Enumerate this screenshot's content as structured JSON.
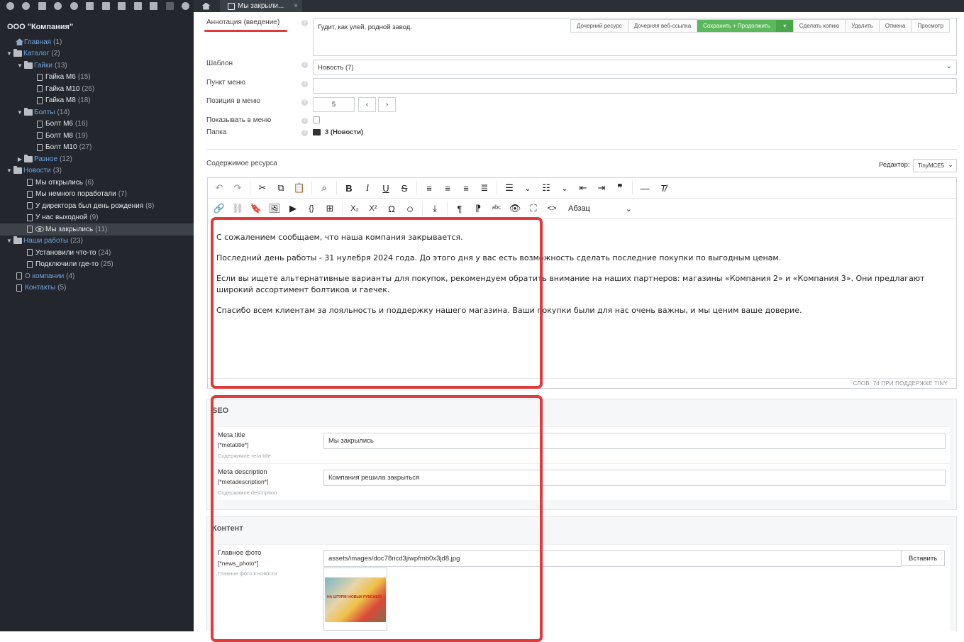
{
  "sidebar": {
    "root_label": "ООО \"Компания\"",
    "toolbar_icons": [
      "arrow-down-circle-icon",
      "arrow-up-circle-icon",
      "new-document-icon",
      "link-icon",
      "refresh-icon",
      "sort-icon",
      "sort-numeric-icon",
      "camera-icon",
      "copy-icon",
      "grid-icon",
      "trash-icon",
      "contrast-icon"
    ],
    "tree": [
      {
        "label": "Главная",
        "count": "(1)",
        "level": 0
      },
      {
        "label": "Каталог",
        "count": "(2)",
        "level": 0
      },
      {
        "label": "Гайки",
        "count": "(13)",
        "level": 1
      },
      {
        "label": "Гайка М6",
        "count": "(15)",
        "level": 2
      },
      {
        "label": "Гайка М10",
        "count": "(26)",
        "level": 2
      },
      {
        "label": "Гайка М8",
        "count": "(18)",
        "level": 2
      },
      {
        "label": "Болты",
        "count": "(14)",
        "level": 1
      },
      {
        "label": "Болт М6",
        "count": "(16)",
        "level": 2
      },
      {
        "label": "Болт М8",
        "count": "(19)",
        "level": 2
      },
      {
        "label": "Болт М10",
        "count": "(27)",
        "level": 2
      },
      {
        "label": "Разное",
        "count": "(12)",
        "level": 1
      },
      {
        "label": "Новости",
        "count": "(3)",
        "level": 0
      },
      {
        "label": "Мы открылись",
        "count": "(6)",
        "level": 1
      },
      {
        "label": "Мы немного поработали",
        "count": "(7)",
        "level": 1
      },
      {
        "label": "У директора был день рождения",
        "count": "(8)",
        "level": 1
      },
      {
        "label": "У нас выходной",
        "count": "(9)",
        "level": 1
      },
      {
        "label": "Мы закрылись",
        "count": "(11)",
        "level": 1
      },
      {
        "label": "Наши работы",
        "count": "(23)",
        "level": 0
      },
      {
        "label": "Установили что-то",
        "count": "(24)",
        "level": 1
      },
      {
        "label": "Подключили где-то",
        "count": "(25)",
        "level": 1
      },
      {
        "label": "О компании",
        "count": "(4)",
        "level": 0
      },
      {
        "label": "Контакты",
        "count": "(5)",
        "level": 0
      }
    ]
  },
  "tabs": {
    "active_label": "Мы закрыли...",
    "close": "×"
  },
  "actions": {
    "child_resource": "Дочерний ресурс",
    "child_weblink": "Дочерняя веб-ссылка",
    "save_continue": "Сохранить + Продолжить",
    "make_copy": "Сделать копию",
    "delete": "Удалить",
    "cancel": "Отмена",
    "view": "Просмотр"
  },
  "form": {
    "annotation_label": "Аннотация (введение)",
    "annotation_value": "Гудит, как улей, родной завод.",
    "template_label": "Шаблон",
    "template_value": "Новость (7)",
    "menu_item_label": "Пункт меню",
    "menu_item_value": "",
    "menu_position_label": "Позиция в меню",
    "menu_position_value": "5",
    "show_in_menu_label": "Показывать в меню",
    "folder_label": "Папка",
    "folder_value": "3 (Новости)",
    "content_label": "Содержимое ресурса",
    "editor_label": "Редактор:",
    "editor_value": "TinyMCE5"
  },
  "editor": {
    "format_select": "Абзац",
    "paragraphs": [
      "С сожалением сообщаем, что наша компания закрывается.",
      "Последний день работы - 31 нулебря 2024 года. До этого дня у вас есть возможность сделать последние покупки по выгодным ценам.",
      "Если вы ищете альтернативные варианты для покупок, рекомендуем обратить внимание на наших партнеров: магазины «Компания 2» и «Компания 3». Они предлагают широкий ассортимент болтиков и гаечек.",
      "Спасибо всем клиентам за лояльность и поддержку нашего магазина. Ваши покупки были для нас очень важны, и мы ценим ваше доверие."
    ],
    "status": "СЛОВ: 74  ПРИ ПОДДЕРЖКЕ TINY"
  },
  "seo": {
    "title": "SEO",
    "meta_title_label": "Meta title",
    "meta_title_tag": "[*metatitle*]",
    "meta_title_desc": "Содержимое тега title",
    "meta_title_value": "Мы закрылись",
    "meta_desc_label": "Meta description",
    "meta_desc_tag": "[*metadescription*]",
    "meta_desc_desc": "Содержимое description",
    "meta_desc_value": "Компания решила закрыться"
  },
  "content_panel": {
    "title": "Контент",
    "photo_label": "Главное фото",
    "photo_tag": "[*news_photo*]",
    "photo_desc": "Главное фото к новости",
    "photo_path": "assets/images/doc78ncd3jiwpfmb0x3jd8.jpg",
    "insert_button": "Вставить",
    "photo_caption": "НА ШТУРМ! НОВЫХ РУБЕЖЕЙ!"
  },
  "colors": {
    "sidebar_bg": "#23272d",
    "link": "#6ea3e0",
    "save_green": "#5cb85c",
    "highlight_red": "#e03a3a"
  }
}
